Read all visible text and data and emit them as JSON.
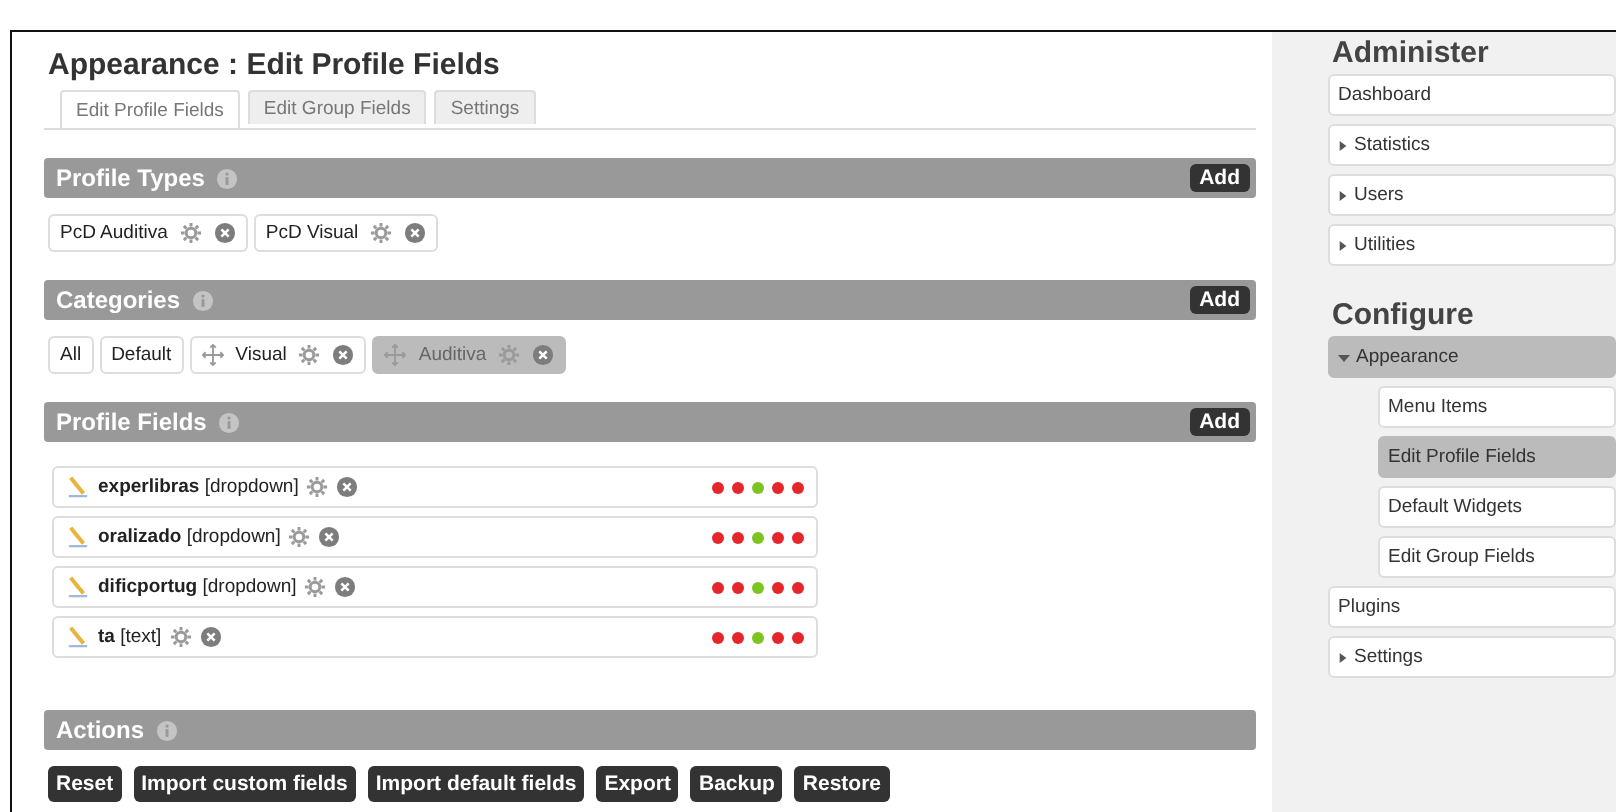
{
  "page": {
    "title": "Appearance : Edit Profile Fields"
  },
  "tabs": [
    {
      "label": "Edit Profile Fields",
      "selected": true
    },
    {
      "label": "Edit Group Fields",
      "selected": false
    },
    {
      "label": "Settings",
      "selected": false
    }
  ],
  "profile_types": {
    "title": "Profile Types",
    "add": "Add",
    "items": [
      {
        "label": "PcD Auditiva"
      },
      {
        "label": "PcD Visual"
      }
    ]
  },
  "categories": {
    "title": "Categories",
    "add": "Add",
    "items": [
      {
        "label": "All",
        "kind": "plain",
        "selected": false
      },
      {
        "label": "Default",
        "kind": "plain",
        "selected": false
      },
      {
        "label": "Visual",
        "kind": "custom",
        "selected": false
      },
      {
        "label": "Auditiva",
        "kind": "custom",
        "selected": true
      }
    ]
  },
  "profile_fields": {
    "title": "Profile Fields",
    "add": "Add",
    "items": [
      {
        "name": "experlibras",
        "type": "[dropdown]",
        "dots": [
          {
            "color": "#e5262b"
          },
          {
            "color": "#e5262b"
          },
          {
            "color": "#7cc520"
          },
          {
            "color": "#e5262b"
          },
          {
            "color": "#e5262b"
          }
        ]
      },
      {
        "name": "oralizado",
        "type": "[dropdown]",
        "dots": [
          {
            "color": "#e5262b"
          },
          {
            "color": "#e5262b"
          },
          {
            "color": "#7cc520"
          },
          {
            "color": "#e5262b"
          },
          {
            "color": "#e5262b"
          }
        ]
      },
      {
        "name": "dificportug",
        "type": "[dropdown]",
        "dots": [
          {
            "color": "#e5262b"
          },
          {
            "color": "#e5262b"
          },
          {
            "color": "#7cc520"
          },
          {
            "color": "#e5262b"
          },
          {
            "color": "#e5262b"
          }
        ]
      },
      {
        "name": "ta",
        "type": "[text]",
        "dots": [
          {
            "color": "#e5262b"
          },
          {
            "color": "#e5262b"
          },
          {
            "color": "#7cc520"
          },
          {
            "color": "#e5262b"
          },
          {
            "color": "#e5262b"
          }
        ]
      }
    ]
  },
  "actions": {
    "title": "Actions",
    "buttons": [
      "Reset",
      "Import custom fields",
      "Import default fields",
      "Export",
      "Backup",
      "Restore"
    ]
  },
  "sidebar": {
    "sections": [
      {
        "title": "Administer",
        "items": [
          {
            "label": "Dashboard",
            "kind": "link",
            "selected": false
          },
          {
            "label": "Statistics",
            "kind": "group",
            "expanded": false,
            "selected": false
          },
          {
            "label": "Users",
            "kind": "group",
            "expanded": false,
            "selected": false
          },
          {
            "label": "Utilities",
            "kind": "group",
            "expanded": false,
            "selected": false
          }
        ]
      },
      {
        "title": "Configure",
        "items": [
          {
            "label": "Appearance",
            "kind": "group",
            "expanded": true,
            "selected": true,
            "children": [
              {
                "label": "Menu Items",
                "selected": false
              },
              {
                "label": "Edit Profile Fields",
                "selected": true
              },
              {
                "label": "Default Widgets",
                "selected": false
              },
              {
                "label": "Edit Group Fields",
                "selected": false
              }
            ]
          },
          {
            "label": "Plugins",
            "kind": "link",
            "selected": false
          },
          {
            "label": "Settings",
            "kind": "group",
            "expanded": false,
            "selected": false
          }
        ]
      }
    ]
  }
}
